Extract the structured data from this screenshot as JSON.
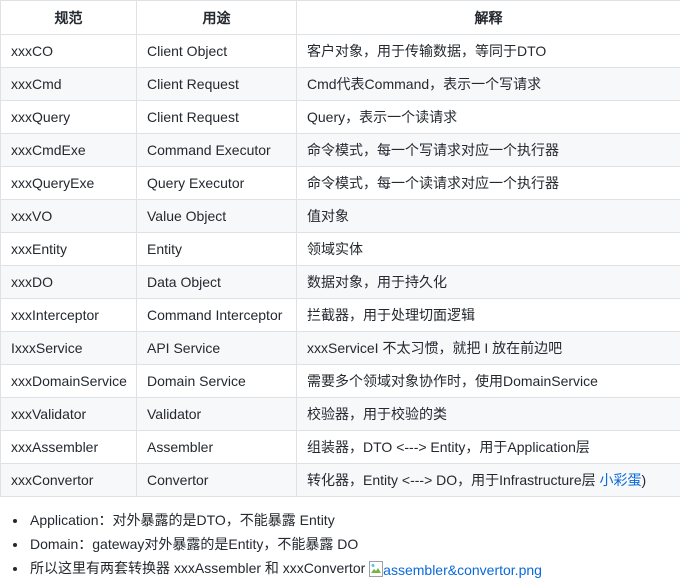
{
  "table": {
    "headers": [
      "规范",
      "用途",
      "解释"
    ],
    "rows": [
      {
        "name": "xxxCO",
        "usage": "Client Object",
        "desc": "客户对象，用于传输数据，等同于DTO"
      },
      {
        "name": "xxxCmd",
        "usage": "Client Request",
        "desc": "Cmd代表Command，表示一个写请求"
      },
      {
        "name": "xxxQuery",
        "usage": "Client Request",
        "desc": "Query，表示一个读请求"
      },
      {
        "name": "xxxCmdExe",
        "usage": "Command Executor",
        "desc": "命令模式，每一个写请求对应一个执行器"
      },
      {
        "name": "xxxQueryExe",
        "usage": "Query Executor",
        "desc": "命令模式，每一个读请求对应一个执行器"
      },
      {
        "name": "xxxVO",
        "usage": "Value Object",
        "desc": "值对象"
      },
      {
        "name": "xxxEntity",
        "usage": "Entity",
        "desc": "领域实体"
      },
      {
        "name": "xxxDO",
        "usage": "Data Object",
        "desc": "数据对象，用于持久化"
      },
      {
        "name": "xxxInterceptor",
        "usage": "Command Interceptor",
        "desc": "拦截器，用于处理切面逻辑"
      },
      {
        "name": "IxxxService",
        "usage": "API Service",
        "desc": "xxxServiceI 不太习惯，就把 I 放在前边吧"
      },
      {
        "name": "xxxDomainService",
        "usage": "Domain Service",
        "desc": "需要多个领域对象协作时，使用DomainService"
      },
      {
        "name": "xxxValidator",
        "usage": "Validator",
        "desc": "校验器，用于校验的类"
      },
      {
        "name": "xxxAssembler",
        "usage": "Assembler",
        "desc": "组装器，DTO <---> Entity，用于Application层"
      },
      {
        "name": "xxxConvertor",
        "usage": "Convertor",
        "desc": "转化器，Entity <---> DO，用于Infrastructure层",
        "link": "小彩蛋",
        "suffix": ")"
      }
    ]
  },
  "notes": {
    "items": [
      "Application：对外暴露的是DTO，不能暴露 Entity",
      "Domain：gateway对外暴露的是Entity，不能暴露 DO",
      "所以这里有两套转换器 xxxAssembler 和 xxxConvertor "
    ],
    "image_alt": "assembler&convertor.png"
  },
  "colors": {
    "link": "#0969da",
    "border": "#dfe2e5",
    "stripe": "#f6f8fa"
  }
}
